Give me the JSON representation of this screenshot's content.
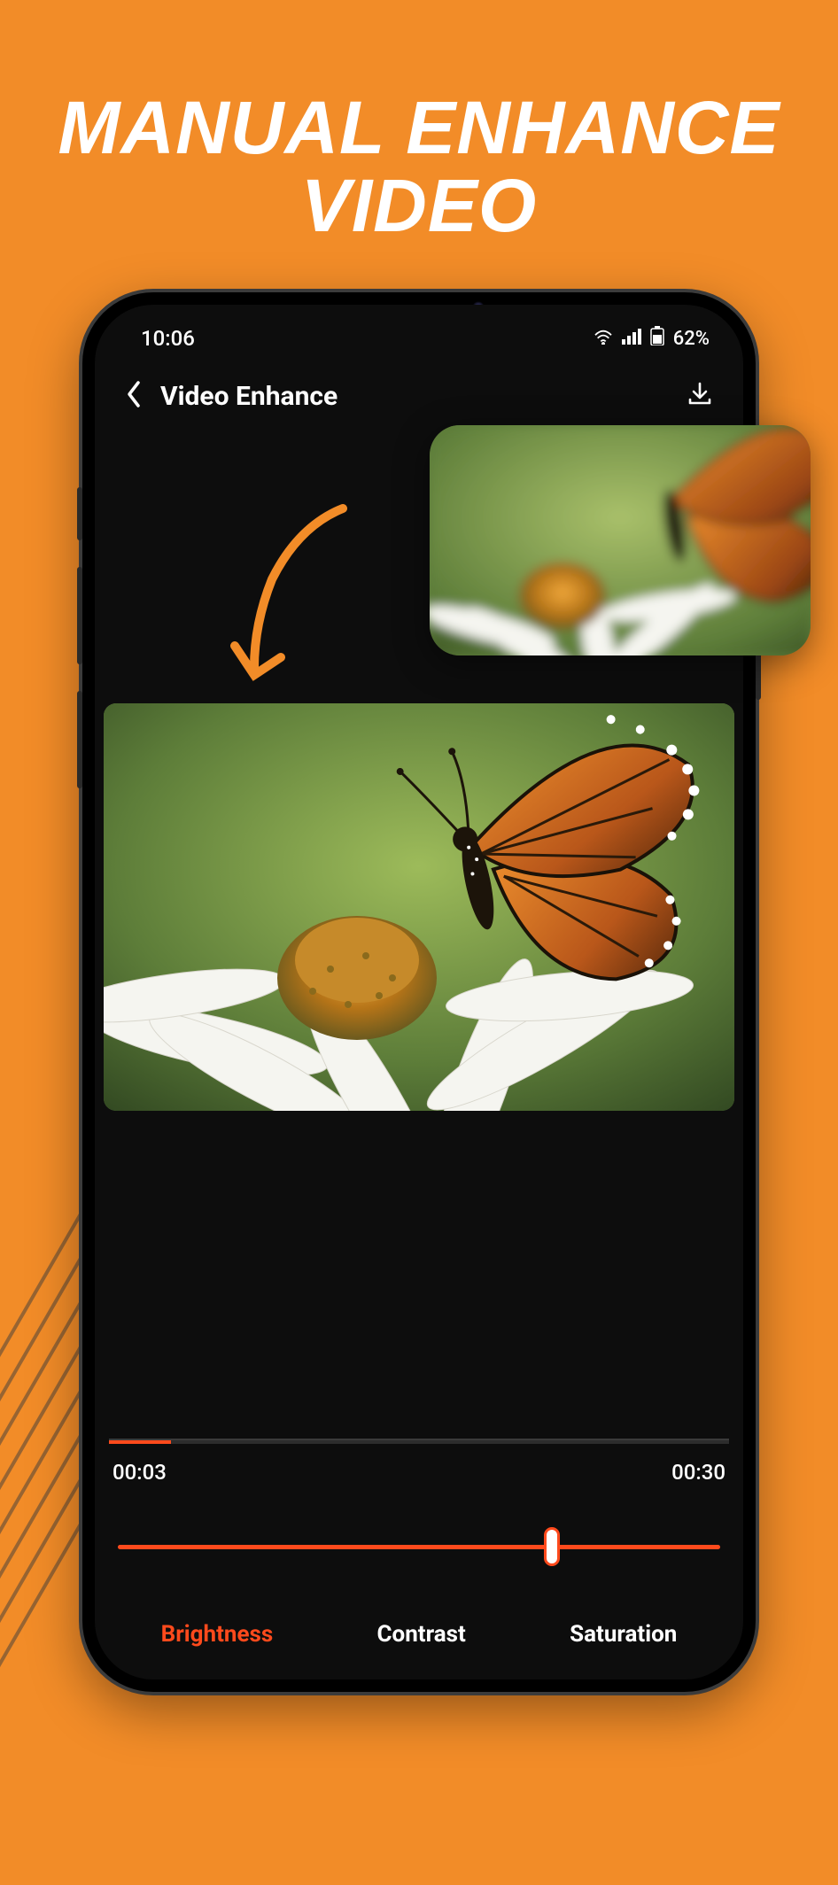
{
  "marketing": {
    "headline_line1": "MANUAL ENHANCE",
    "headline_line2": "VIDEO"
  },
  "statusbar": {
    "time": "10:06",
    "battery_text": "62%"
  },
  "header": {
    "title": "Video Enhance"
  },
  "timeline": {
    "current": "00:03",
    "duration": "00:30",
    "progress_percent": 10
  },
  "slider": {
    "position_percent": 72
  },
  "tabs": {
    "brightness": "Brightness",
    "contrast": "Contrast",
    "saturation": "Saturation"
  },
  "icons": {
    "back": "back-chevron-icon",
    "download": "download-icon",
    "wifi": "wifi-icon",
    "signal": "cell-signal-icon",
    "battery": "battery-icon",
    "arrow": "curved-arrow-icon"
  }
}
